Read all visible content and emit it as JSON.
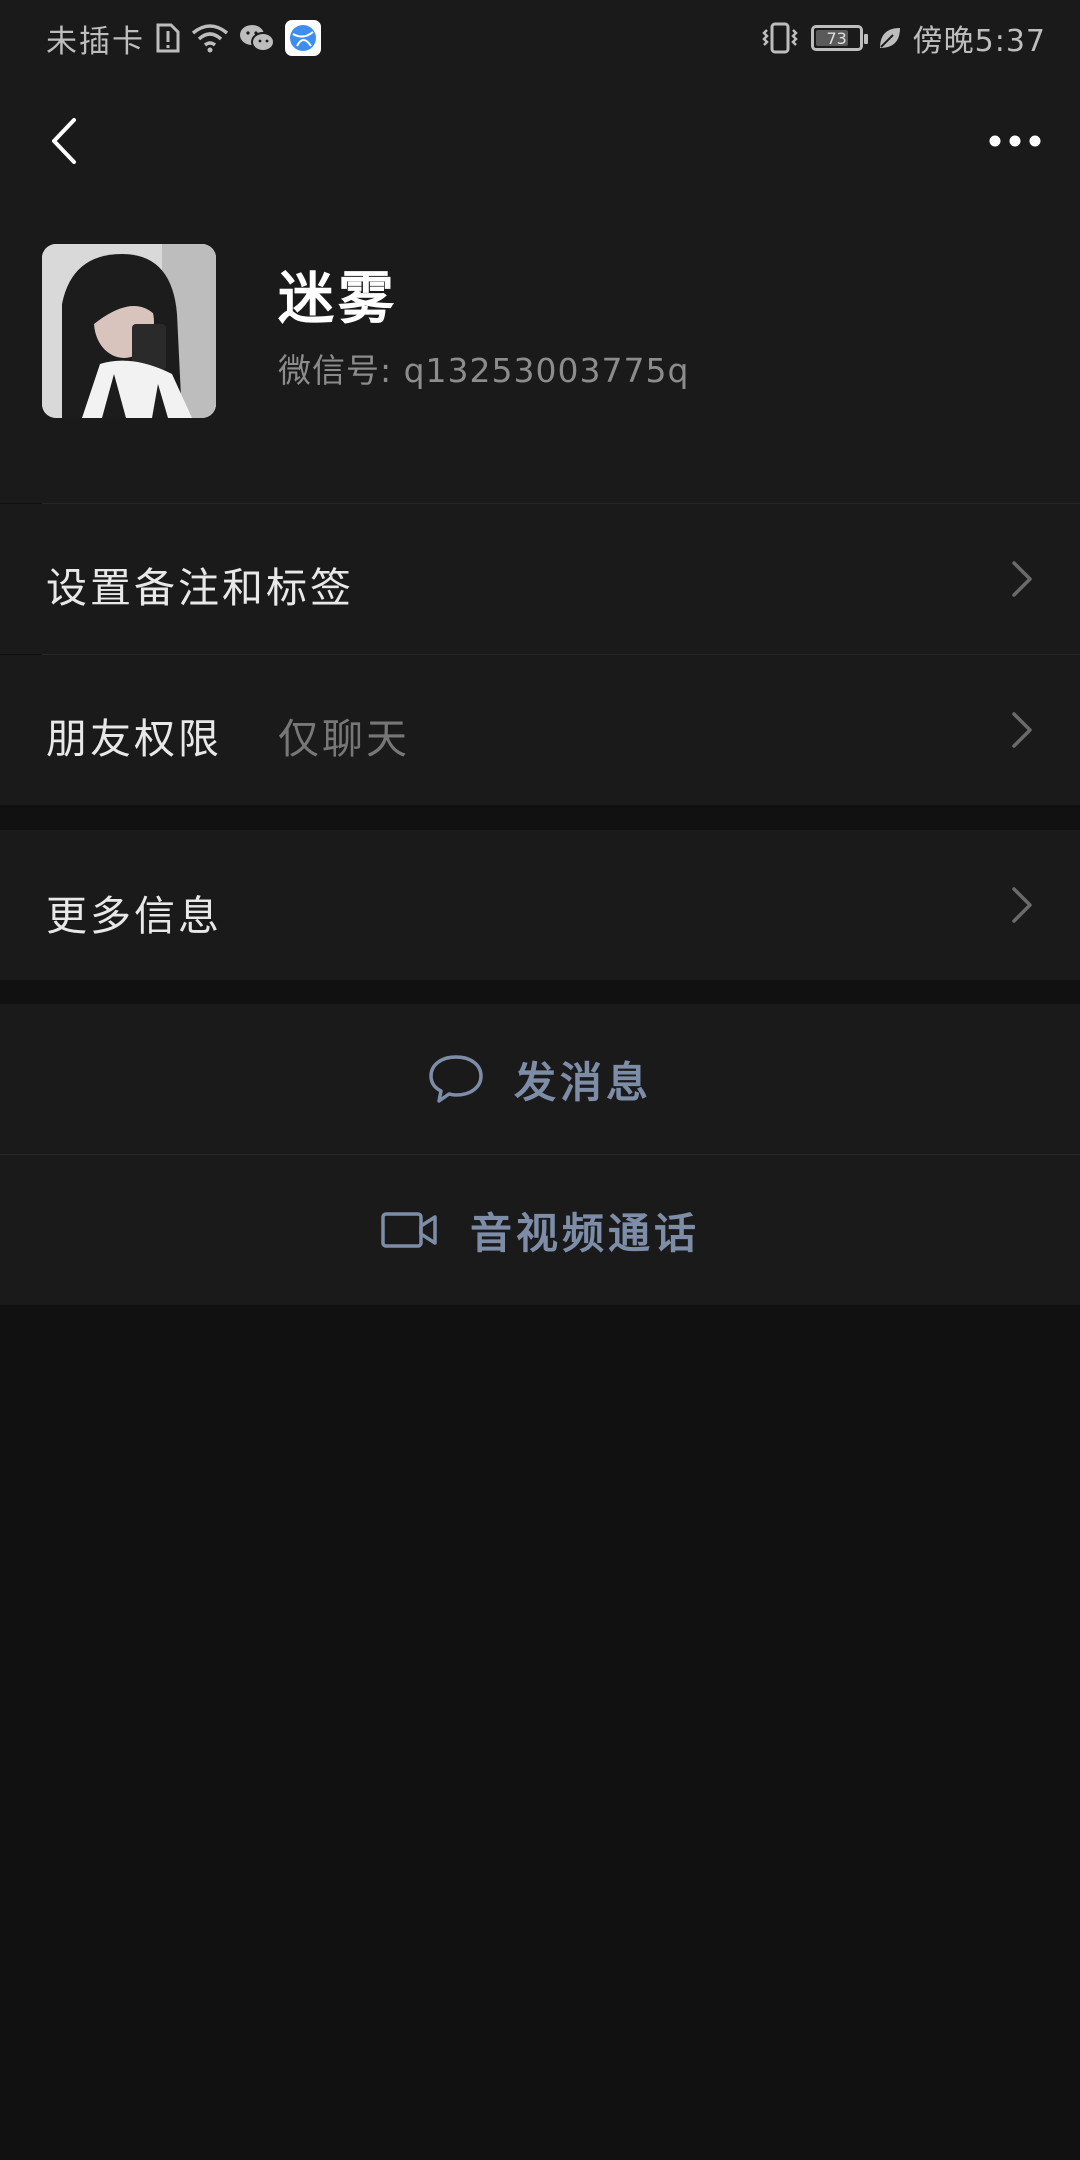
{
  "status_bar": {
    "carrier": "未插卡",
    "time": "傍晚5:37",
    "battery_level": "73",
    "icons": [
      "sim-alert-icon",
      "wifi-icon",
      "wechat-icon",
      "browser-icon",
      "vibrate-icon",
      "battery-icon",
      "leaf-icon"
    ]
  },
  "nav": {
    "back_icon": "chevron-left-icon",
    "more_icon": "more-dots-icon"
  },
  "profile": {
    "name": "迷雾",
    "wechat_id_label": "微信号: ",
    "wechat_id": "q13253003775q"
  },
  "rows": {
    "remark": {
      "label": "设置备注和标签"
    },
    "permissions": {
      "label": "朋友权限",
      "value": "仅聊天"
    },
    "more_info": {
      "label": "更多信息"
    }
  },
  "actions": {
    "message": {
      "label": "发消息",
      "icon": "chat-bubble-icon"
    },
    "call": {
      "label": "音视频通话",
      "icon": "video-camera-icon"
    }
  },
  "colors": {
    "background": "#111111",
    "surface": "#1a1a1a",
    "accent_link": "#7d8da8",
    "text_primary": "#e8e8e8",
    "text_secondary": "#8c8c8c"
  }
}
